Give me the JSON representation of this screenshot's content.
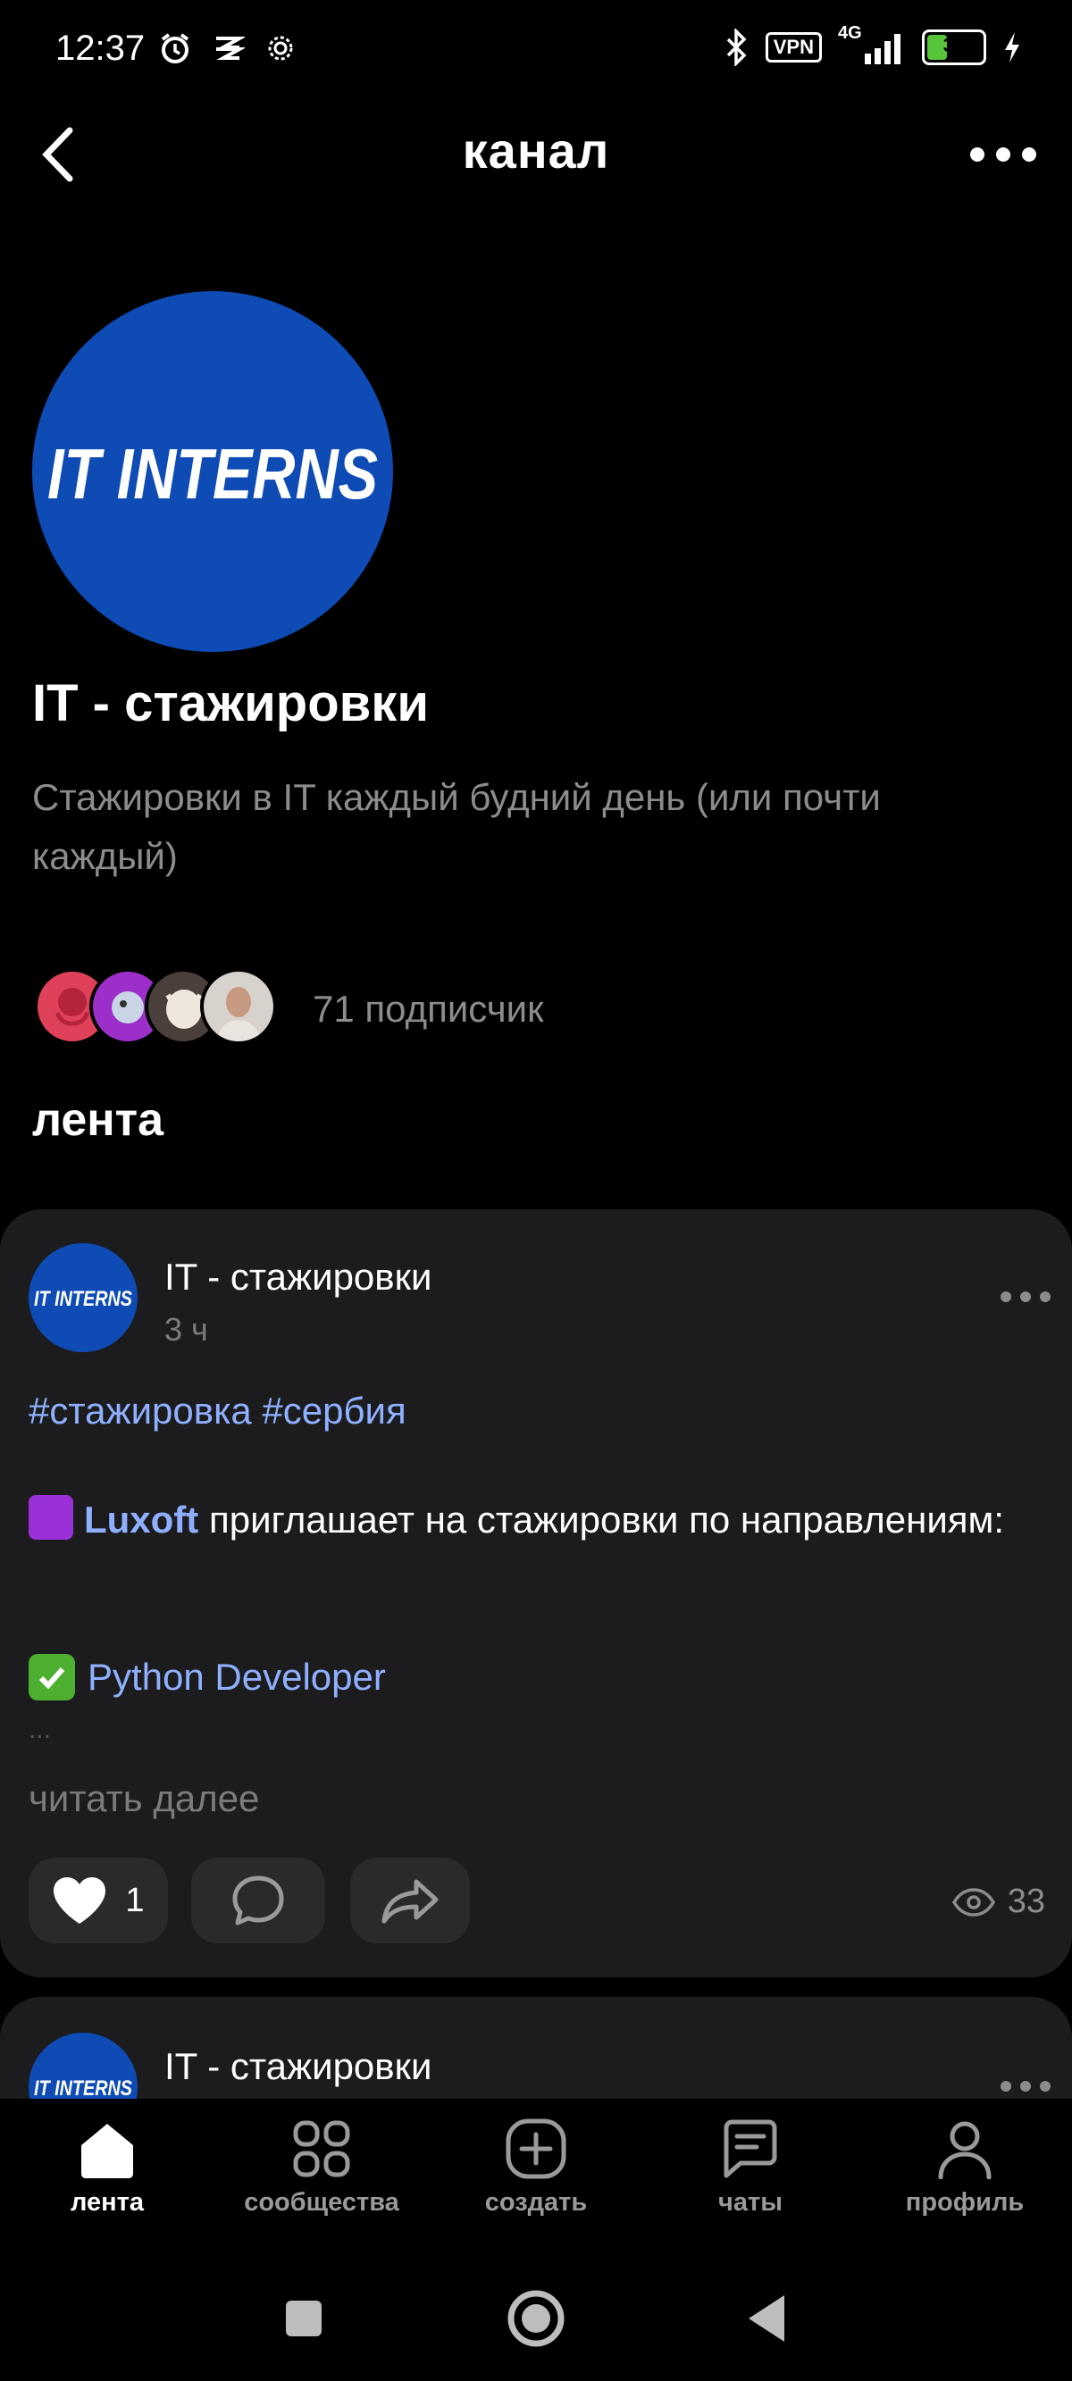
{
  "status_bar": {
    "time": "12:37",
    "vpn_label": "VPN",
    "network": "4G",
    "battery": "35",
    "icons": [
      "alarm-icon",
      "app-notification-icon",
      "settings-gear-icon",
      "bluetooth-icon",
      "signal-icon",
      "charging-icon"
    ]
  },
  "header": {
    "title": "канал",
    "back_icon": "chevron-left-icon",
    "more_icon": "more-horizontal-icon"
  },
  "channel": {
    "logo_text": "IT INTERNS",
    "name": "IT - стажировки",
    "description": "Стажировки в IT каждый будний день (или почти каждый)",
    "subscribers": "71 подписчик"
  },
  "feed_label": "лента",
  "post": {
    "author": "IT - стажировки",
    "avatar_text": "IT INTERNS",
    "time": "3 ч",
    "hashtags": "#стажировка #сербия",
    "brand": "Luxoft",
    "text_after_brand": " приглашает на стажировки по направлениям:",
    "role": "Python Developer",
    "ellipsis": "...",
    "read_more": "читать далее",
    "likes": "1",
    "views": "33",
    "accent": "#8fb0ff"
  },
  "next_post": {
    "author": "IT - стажировки",
    "avatar_text": "IT INTERNS"
  },
  "tabs": [
    {
      "label": "лента",
      "icon": "home-icon",
      "active": true
    },
    {
      "label": "сообщества",
      "icon": "grid-icon",
      "active": false
    },
    {
      "label": "создать",
      "icon": "plus-square-icon",
      "active": false
    },
    {
      "label": "чаты",
      "icon": "chat-icon",
      "active": false
    },
    {
      "label": "профиль",
      "icon": "profile-icon",
      "active": false
    }
  ],
  "colors": {
    "background": "#000000",
    "card": "#1c1c1e",
    "brand_blue": "#0e4bb5",
    "muted_text": "#8c8c8c"
  }
}
